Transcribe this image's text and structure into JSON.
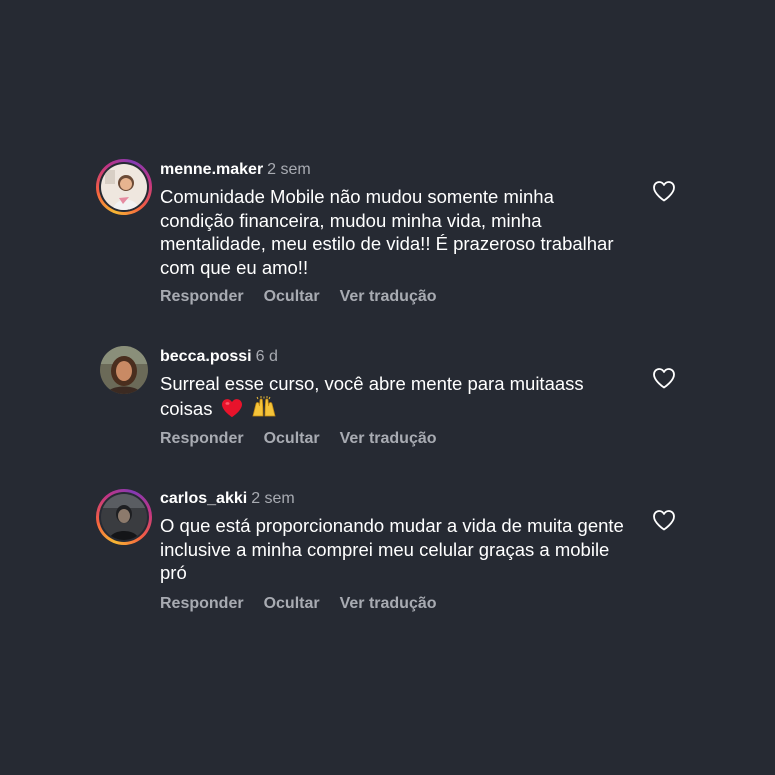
{
  "comments": [
    {
      "username": "menne.maker",
      "time": "2 sem",
      "text": "Comunidade Mobile não mudou somente minha condição financeira, mudou minha vida, minha mentalidade, meu estilo de vida!! É prazeroso trabalhar com que eu amo!!",
      "emoji": [],
      "has_story_ring": true,
      "actions": {
        "reply": "Responder",
        "hide": "Ocultar",
        "translate": "Ver tradução"
      }
    },
    {
      "username": "becca.possi",
      "time": "6 d",
      "text": "Surreal esse curso, você abre mente para muitaass coisas",
      "emoji": [
        "heart",
        "raising-hands"
      ],
      "has_story_ring": false,
      "actions": {
        "reply": "Responder",
        "hide": "Ocultar",
        "translate": "Ver tradução"
      }
    },
    {
      "username": "carlos_akki",
      "time": "2 sem",
      "text": "O que está proporcionando mudar a vida de muita gente inclusive a minha comprei meu celular graças a mobile pró",
      "emoji": [],
      "has_story_ring": true,
      "actions": {
        "reply": "Responder",
        "hide": "Ocultar",
        "translate": "Ver tradução"
      }
    }
  ],
  "icons": {
    "like": "heart-outline-icon"
  },
  "colors": {
    "background": "#262a33",
    "text_primary": "#ffffff",
    "text_secondary": "#a8abb2",
    "heart_emoji": "#e8132b"
  }
}
